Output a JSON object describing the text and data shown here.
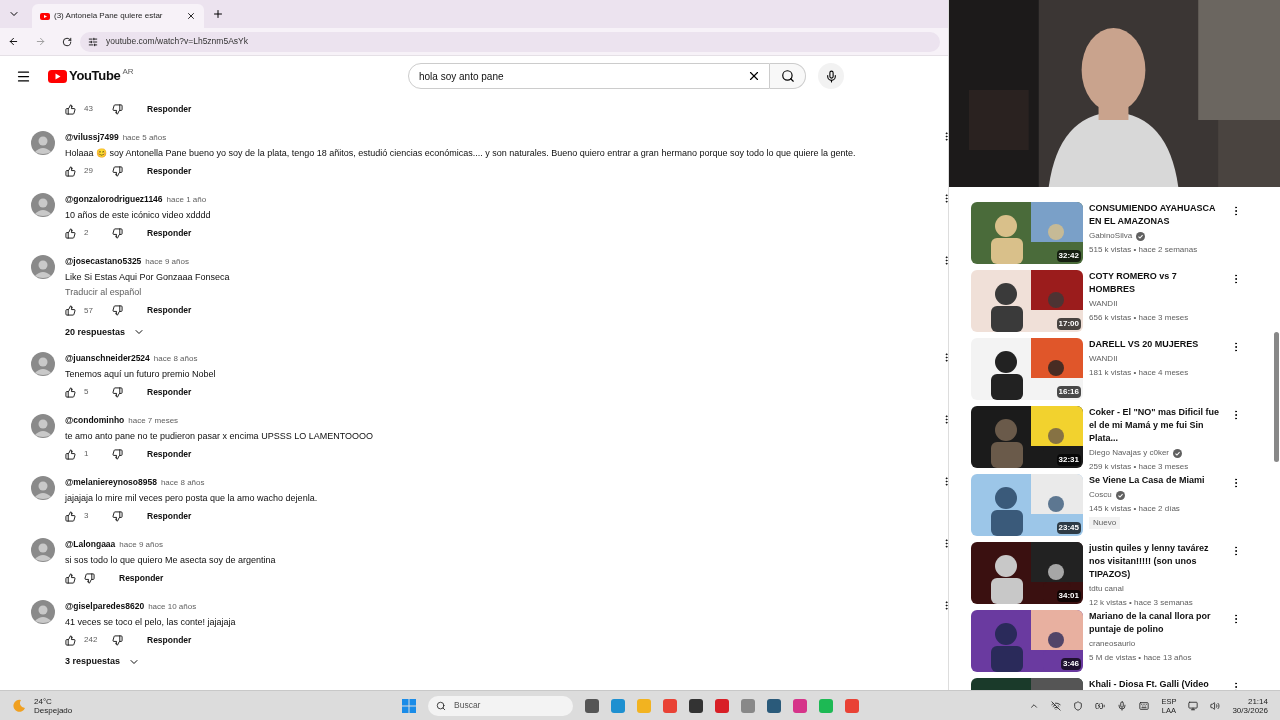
{
  "browser": {
    "tab": {
      "title": "(3) Antonela Pane quiere estar",
      "selected": true
    },
    "url": "youtube.com/watch?v=Lh5znm5AsYk"
  },
  "header": {
    "logo": "YouTube",
    "region": "AR",
    "search": "hola soy anto pane"
  },
  "comments": [
    {
      "kind": "actions",
      "likes": "43",
      "reply": "Responder"
    },
    {
      "kind": "comment",
      "author": "@vilussj7499",
      "time": "hace 5 años",
      "text": "Holaaa 😊 soy Antonella Pane bueno yo soy de la plata, tengo 18 añitos, estudió ciencias económicas.... y son naturales. Bueno quiero entrar a gran hermano porque soy todo lo que quiere la gente.",
      "likes": "29",
      "reply": "Responder"
    },
    {
      "kind": "comment",
      "author": "@gonzalorodriguez1146",
      "time": "hace 1 año",
      "text": "10 años de este icónico video xdddd",
      "likes": "2",
      "reply": "Responder"
    },
    {
      "kind": "comment",
      "author": "@josecastano5325",
      "time": "hace 9 años",
      "text": "Like Si Estas Aqui Por Gonzaaa Fonseca",
      "translate": "Traducir al español",
      "likes": "57",
      "reply": "Responder",
      "replies": "20 respuestas"
    },
    {
      "kind": "comment",
      "author": "@juanschneider2524",
      "time": "hace 8 años",
      "text": "Tenemos aquí un futuro premio Nobel",
      "likes": "5",
      "reply": "Responder"
    },
    {
      "kind": "comment",
      "author": "@condominho",
      "time": "hace 7 meses",
      "text": "te amo anto pane no te pudieron pasar x encima UPSSS LO LAMENTOOOO",
      "likes": "1",
      "reply": "Responder"
    },
    {
      "kind": "comment",
      "author": "@melaniereynoso8958",
      "time": "hace 8 años",
      "text": "jajajaja lo mire mil veces pero posta que la amo wacho dejenla.",
      "likes": "3",
      "reply": "Responder"
    },
    {
      "kind": "comment",
      "author": "@Lalongaaa",
      "time": "hace 9 años",
      "text": "si sos todo lo que quiero Me asecta soy de argentina",
      "reply": "Responder"
    },
    {
      "kind": "comment",
      "author": "@giselparedes8620",
      "time": "hace 10 años",
      "text": "41 veces se toco el pelo, las conte! jajajaja",
      "likes": "242",
      "reply": "Responder",
      "replies": "3 respuestas"
    }
  ],
  "videos": [
    {
      "title": "CONSUMIENDO AYAHUASCA EN EL AMAZONAS",
      "channel": "GabinoSilva",
      "verified": true,
      "meta": "515 k vistas • hace 2 semanas",
      "duration": "32:42"
    },
    {
      "title": "COTY ROMERO vs 7 HOMBRES",
      "channel": "WANDII",
      "verified": false,
      "meta": "656 k vistas • hace 3 meses",
      "duration": "17:00"
    },
    {
      "title": "DARELL VS 20 MUJERES",
      "channel": "WANDII",
      "verified": false,
      "meta": "181 k vistas • hace 4 meses",
      "duration": "16:16"
    },
    {
      "title": "Coker - El \"NO\" mas Dificil fue el de mi Mamá y me fui Sin Plata...",
      "channel": "Diego Navajas y c0ker",
      "verified": true,
      "meta": "259 k vistas • hace 3 meses",
      "duration": "32:31"
    },
    {
      "title": "Se Viene La Casa de Miami",
      "channel": "Coscu",
      "verified": true,
      "meta": "145 k vistas • hace 2 días",
      "badge": "Nuevo",
      "duration": "23:45"
    },
    {
      "title": "justin quiles y lenny tavárez nos visitan!!!!! (son unos TIPAZOS)",
      "channel": "tdtu canal",
      "verified": false,
      "meta": "12 k vistas • hace 3 semanas",
      "duration": "34:01"
    },
    {
      "title": "Mariano de la canal llora por puntaje de polino",
      "channel": "craneosaurio",
      "verified": false,
      "meta": "5 M de vistas • hace 13 años",
      "duration": "3:46"
    },
    {
      "title": "Khali - Diosa Ft. Galli (Video"
    }
  ],
  "taskbar": {
    "temp": "24°C",
    "weather": "Despejado",
    "search": "Buscar",
    "lang": "ESP",
    "layout": "LAA",
    "time": "21:14",
    "date": "30/3/2026"
  }
}
